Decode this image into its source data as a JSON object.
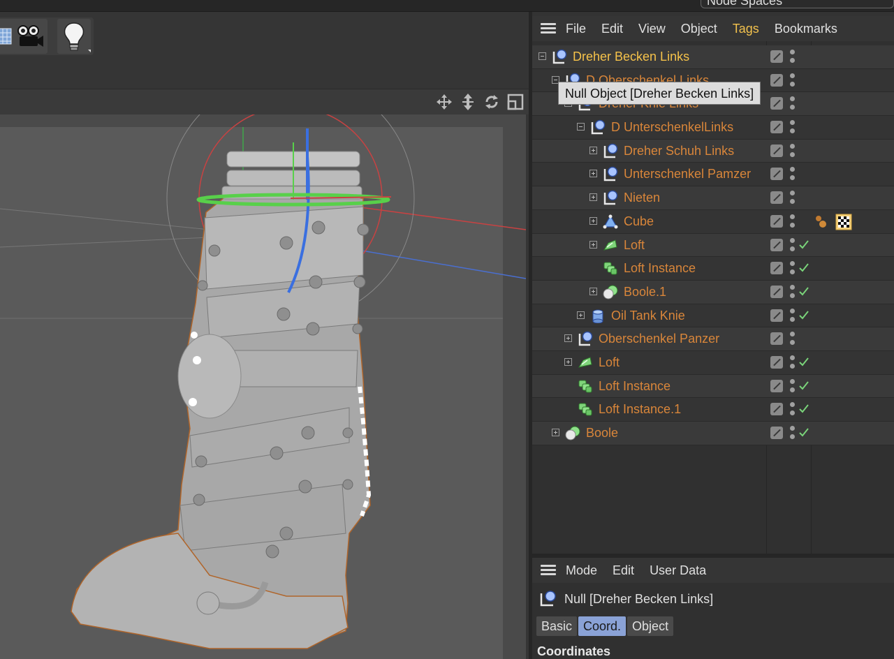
{
  "top": {
    "node_spaces": "Node Spaces"
  },
  "object_manager": {
    "menu": [
      "File",
      "Edit",
      "View",
      "Object",
      "Tags",
      "Bookmarks"
    ],
    "active_menu": "Tags",
    "rows": [
      {
        "label": "Dreher Becken Links",
        "icon": "null-icon",
        "selected": true,
        "check": false
      },
      {
        "label": "D Oberschenkel Links",
        "icon": "null-icon",
        "selected": false,
        "check": false
      },
      {
        "label": "Dreher Knie Links",
        "icon": "null-icon",
        "selected": false,
        "check": false
      },
      {
        "label": "D UnterschenkelLinks",
        "icon": "null-icon",
        "selected": false,
        "check": false
      },
      {
        "label": "Dreher Schuh Links",
        "icon": "null-icon",
        "selected": false,
        "check": false
      },
      {
        "label": "Unterschenkel Pamzer",
        "icon": "null-icon",
        "selected": false,
        "check": false
      },
      {
        "label": "Nieten",
        "icon": "null-icon",
        "selected": false,
        "check": false
      },
      {
        "label": "Cube",
        "icon": "cube-icon",
        "selected": false,
        "check": false,
        "tags": [
          "material-spheres-tag-icon",
          "checker-texture-tag-icon"
        ]
      },
      {
        "label": "Loft",
        "icon": "loft-icon",
        "selected": false,
        "check": true
      },
      {
        "label": "Loft Instance",
        "icon": "instance-icon",
        "selected": false,
        "check": true
      },
      {
        "label": "Boole.1",
        "icon": "boole-icon",
        "selected": false,
        "check": true
      },
      {
        "label": "Oil Tank Knie",
        "icon": "cylinder-icon",
        "selected": false,
        "check": true
      },
      {
        "label": "Oberschenkel Panzer",
        "icon": "null-icon",
        "selected": false,
        "check": false
      },
      {
        "label": "Loft",
        "icon": "loft-icon",
        "selected": false,
        "check": true
      },
      {
        "label": "Loft Instance",
        "icon": "instance-icon",
        "selected": false,
        "check": true
      },
      {
        "label": "Loft Instance.1",
        "icon": "instance-icon",
        "selected": false,
        "check": true
      },
      {
        "label": "Boole",
        "icon": "boole-icon",
        "selected": false,
        "check": true
      }
    ],
    "tooltip": "Null Object [Dreher Becken Links]"
  },
  "attribute_manager": {
    "menu": [
      "Mode",
      "Edit",
      "User Data"
    ],
    "title": "Null [Dreher Becken Links]",
    "tabs": [
      "Basic",
      "Coord.",
      "Object"
    ],
    "active_tab": "Coord.",
    "section": "Coordinates"
  },
  "colors": {
    "accent": "#f2c14d",
    "object_label": "#d9863a",
    "check": "#7ad47a",
    "active_tab": "#8aa2d6"
  }
}
